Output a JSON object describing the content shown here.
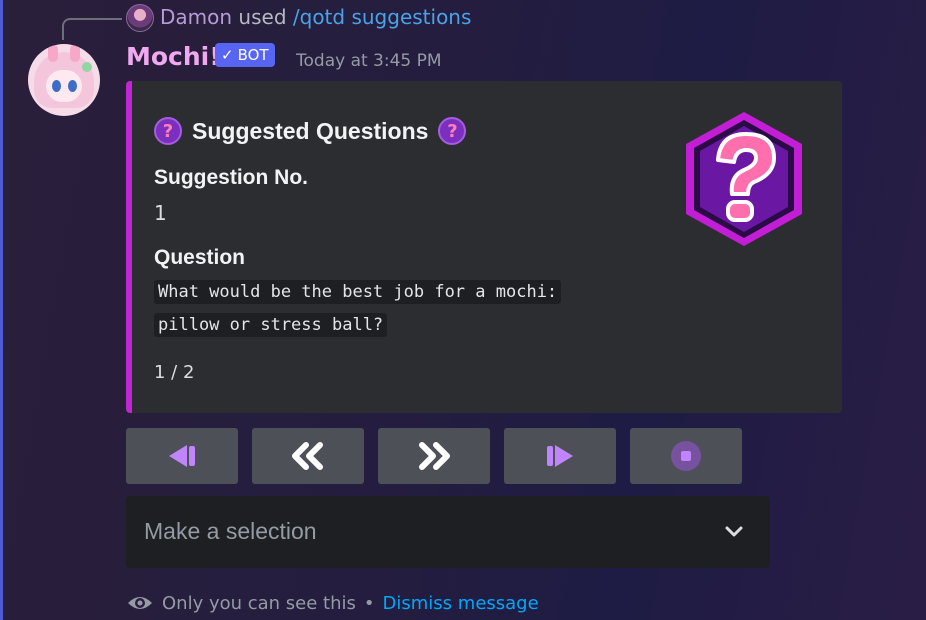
{
  "reply": {
    "user": "Damon",
    "action": "used",
    "command": "/qotd suggestions"
  },
  "message": {
    "author": "Mochi!",
    "bot_tag": "BOT",
    "timestamp": "Today at 3:45 PM"
  },
  "embed": {
    "accent_color": "#c026d3",
    "title": "Suggested Questions",
    "title_icon": "question-badge-icon",
    "fields": [
      {
        "name": "Suggestion No.",
        "value": "1"
      },
      {
        "name": "Question",
        "value_lines": [
          "What would be the best job for a mochi:",
          "pillow or stress ball?"
        ]
      }
    ],
    "footer": "1 / 2",
    "thumbnail": "question-mark-hexagon-icon"
  },
  "buttons": [
    {
      "icon": "skip-to-first-icon"
    },
    {
      "icon": "double-chevron-left-icon"
    },
    {
      "icon": "double-chevron-right-icon"
    },
    {
      "icon": "skip-to-last-icon"
    },
    {
      "icon": "stop-icon"
    }
  ],
  "select": {
    "placeholder": "Make a selection",
    "icon": "chevron-down-icon"
  },
  "ephemeral": {
    "notice": "Only you can see this",
    "separator": "•",
    "dismiss": "Dismiss message"
  }
}
